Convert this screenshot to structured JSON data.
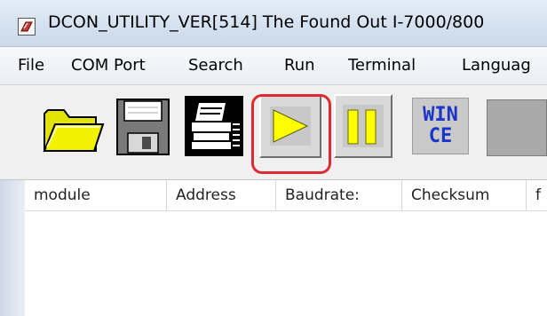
{
  "window": {
    "title": "DCON_UTILITY_VER[514] The Found Out I-7000/800"
  },
  "menu": {
    "items": [
      "File",
      "COM Port",
      "Search",
      "Run",
      "Terminal",
      "Languag"
    ]
  },
  "toolbar": {
    "buttons": [
      {
        "icon": "folder-open-icon"
      },
      {
        "icon": "floppy-disk-icon"
      },
      {
        "icon": "printer-icon"
      },
      {
        "icon": "play-icon",
        "highlighted": true
      },
      {
        "icon": "pause-icon"
      },
      {
        "icon": "wince-icon",
        "label_line1": "WIN",
        "label_line2": "CE"
      },
      {
        "icon": "blank-button-icon"
      }
    ],
    "highlight_color": "#dd2b31"
  },
  "table": {
    "columns": [
      "module",
      "Address",
      "Baudrate:",
      "Checksum",
      "f"
    ]
  },
  "colors": {
    "play_yellow": "#ffff00",
    "folder_yellow": "#e6e600",
    "wince_blue": "#1a35c8"
  }
}
